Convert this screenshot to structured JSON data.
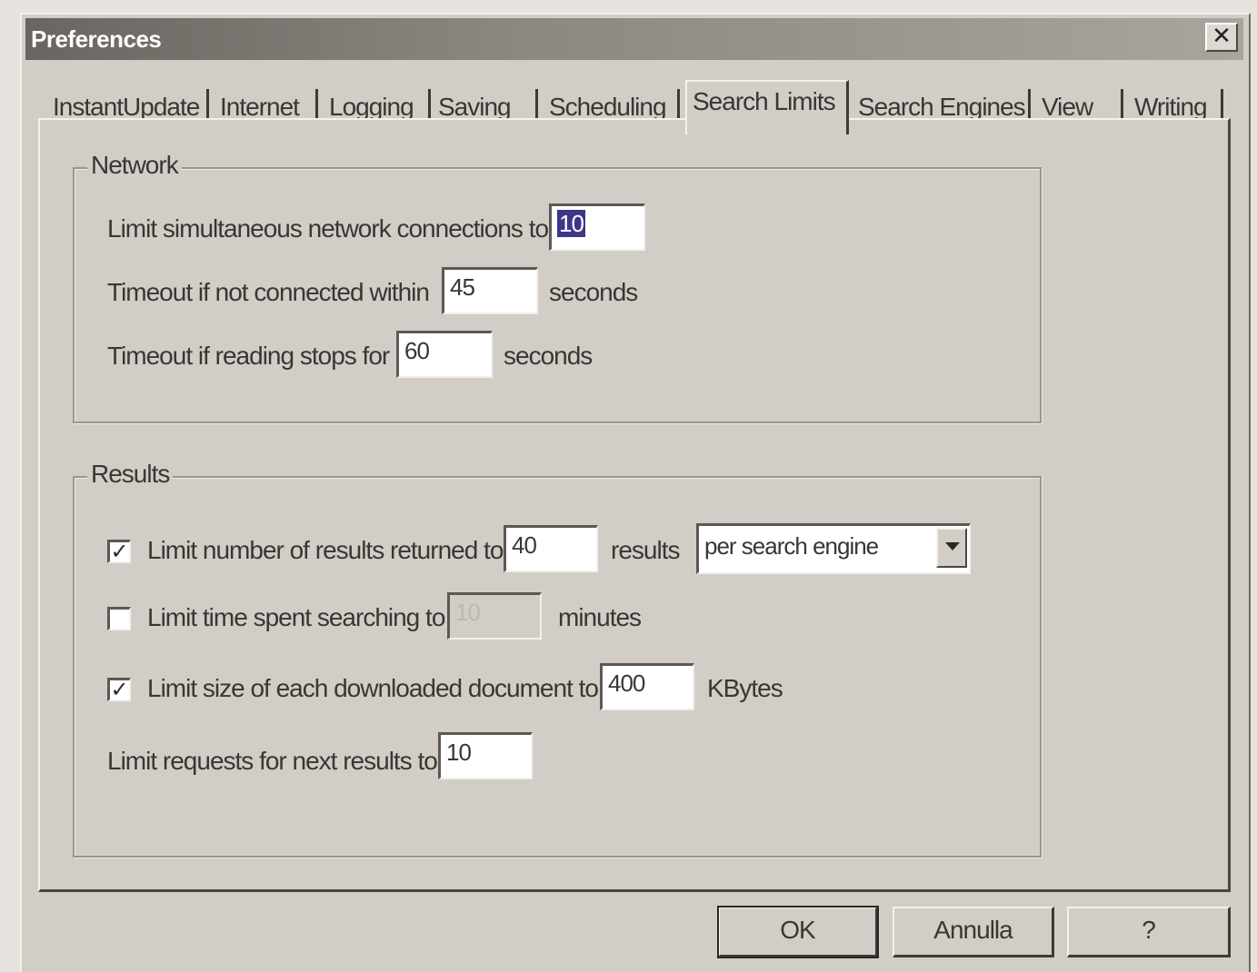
{
  "window": {
    "title": "Preferences",
    "close_glyph": "✕"
  },
  "tabs": [
    {
      "label": "InstantUpdate",
      "active": false
    },
    {
      "label": "Internet",
      "active": false
    },
    {
      "label": "Logging",
      "active": false
    },
    {
      "label": "Saving",
      "active": false
    },
    {
      "label": "Scheduling",
      "active": false
    },
    {
      "label": "Search Limits",
      "active": true
    },
    {
      "label": "Search Engines",
      "active": false
    },
    {
      "label": "View",
      "active": false
    },
    {
      "label": "Writing",
      "active": false
    }
  ],
  "network": {
    "title": "Network",
    "connections_label": "Limit simultaneous network connections to",
    "connections_value": "10",
    "connect_timeout_label": "Timeout if not connected within",
    "connect_timeout_value": "45",
    "connect_timeout_unit": "seconds",
    "read_timeout_label": "Timeout if reading stops for",
    "read_timeout_value": "60",
    "read_timeout_unit": "seconds"
  },
  "results": {
    "title": "Results",
    "limit_results_checked": true,
    "limit_results_label": "Limit number of results returned to",
    "limit_results_value": "40",
    "limit_results_unit": "results",
    "limit_results_scope": "per search engine",
    "limit_time_checked": false,
    "limit_time_label": "Limit time spent searching to",
    "limit_time_value": "10",
    "limit_time_unit": "minutes",
    "limit_size_checked": true,
    "limit_size_label": "Limit size of each downloaded document to",
    "limit_size_value": "400",
    "limit_size_unit": "KBytes",
    "next_results_label": "Limit requests for next results to",
    "next_results_value": "10"
  },
  "buttons": {
    "ok": "OK",
    "cancel": "Annulla",
    "help": "?"
  },
  "glyphs": {
    "check": "✓"
  }
}
